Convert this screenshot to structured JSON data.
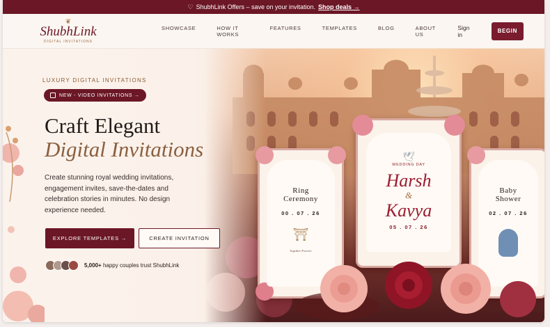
{
  "promo": {
    "icon": "heart-icon",
    "text": "ShubhLink Offers – save on your invitation.",
    "link": "Shop deals →"
  },
  "header": {
    "logo_name": "ShubhLink",
    "logo_sub": "DIGITAL INVITATIONS",
    "nav": [
      "SHOWCASE",
      "HOW IT WORKS",
      "FEATURES",
      "TEMPLATES",
      "BLOG",
      "ABOUT US"
    ],
    "signin": "Sign in",
    "begin": "BEGIN"
  },
  "hero": {
    "eyebrow": "LUXURY DIGITAL INVITATIONS",
    "pill": "NEW - VIDEO INVITATIONS →",
    "title_line1": "Craft Elegant",
    "title_line2": "Digital Invitations",
    "description": "Create stunning royal wedding invitations, engagement invites, save-the-dates and celebration stories in minutes. No design experience needed.",
    "cta_primary": "EXPLORE TEMPLATES →",
    "cta_secondary": "CREATE INVITATION",
    "social_count": "5,000+",
    "social_text": "happy couples trust ShubhLink"
  },
  "cards": {
    "ring": {
      "title1": "Ring",
      "title2": "Ceremony",
      "date": "00 . 07 . 26",
      "footer": "Together Forever"
    },
    "wedding": {
      "label": "WEDDING DAY",
      "name1": "Harsh",
      "amp": "&",
      "name2": "Kavya",
      "date": "05 . 07 . 26"
    },
    "baby": {
      "title1": "Baby",
      "title2": "Shower",
      "date": "02 . 07 . 26"
    }
  },
  "colors": {
    "brand": "#6b1726",
    "gold": "#8a6040",
    "background": "#fbf4ef"
  }
}
